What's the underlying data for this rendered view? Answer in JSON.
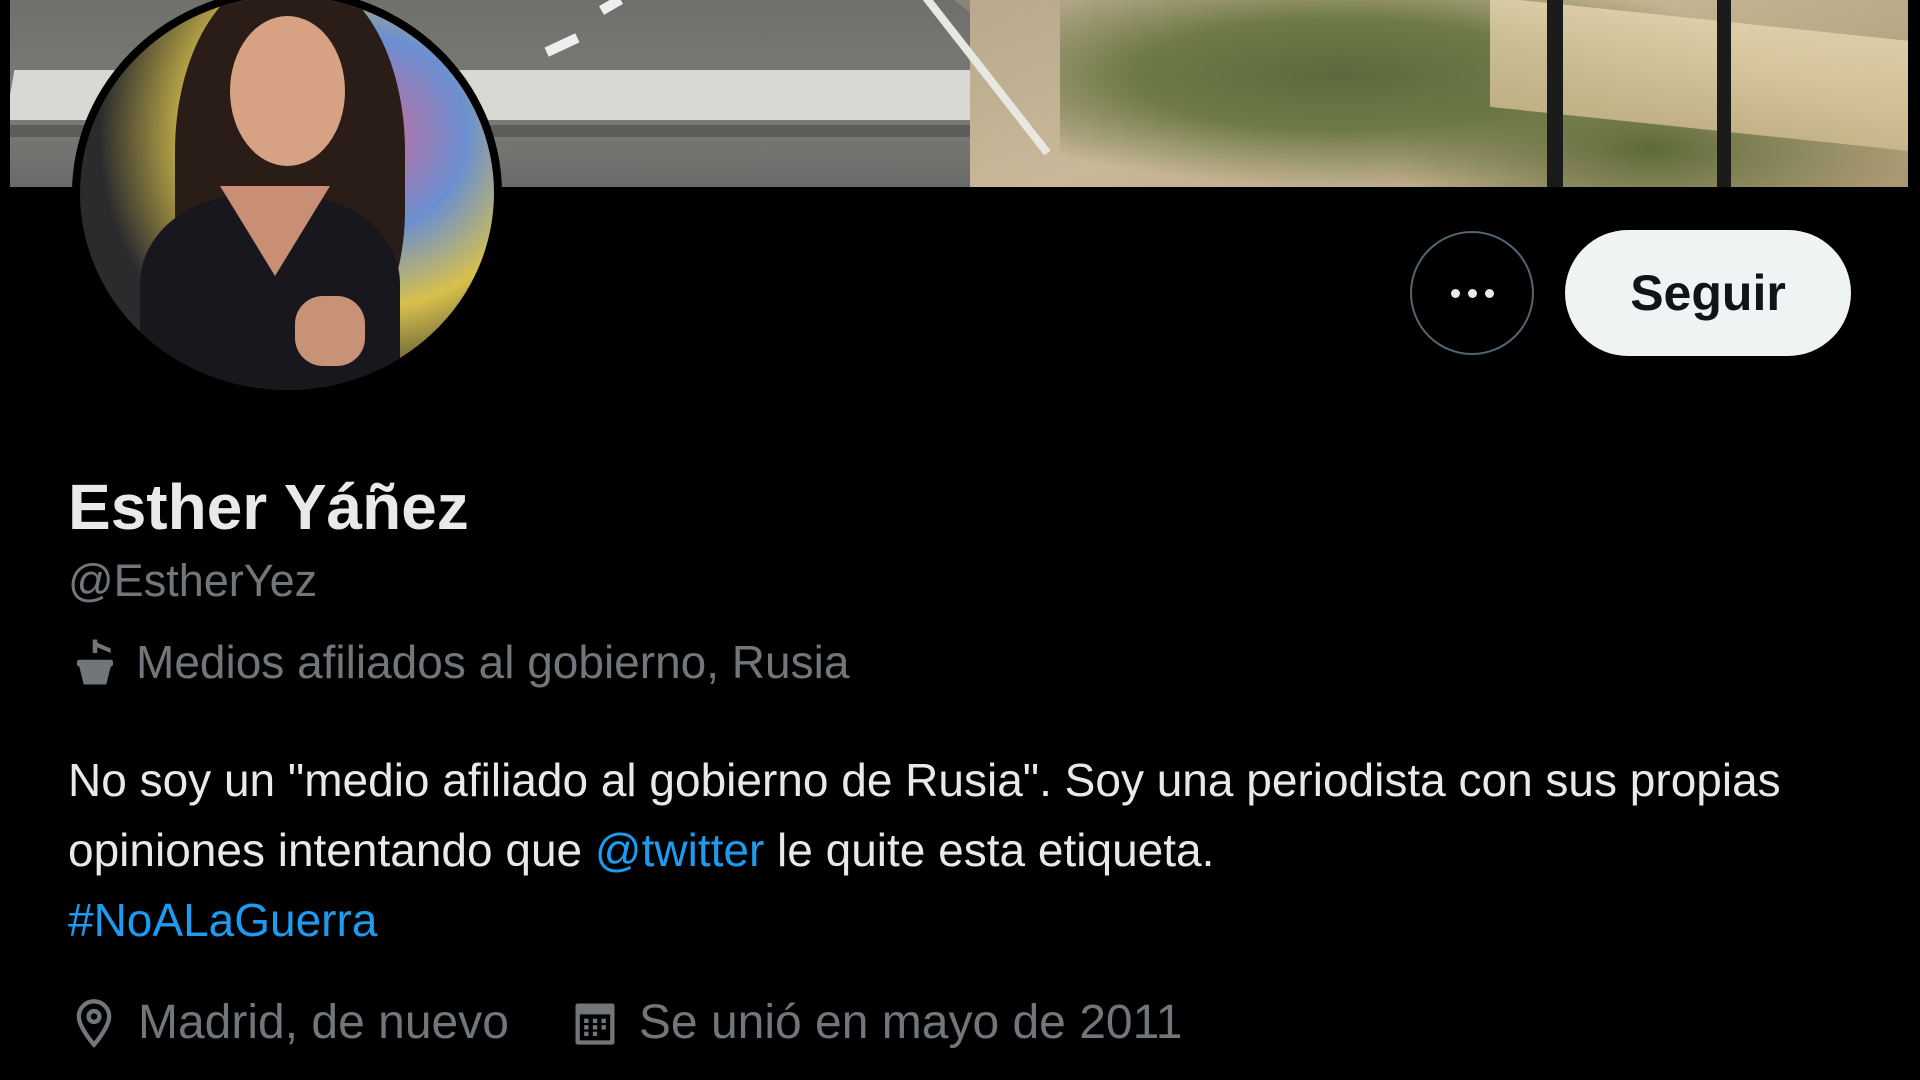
{
  "profile": {
    "name": "Esther Yáñez",
    "handle": "@EstherYez",
    "label": {
      "icon": "podium-icon",
      "text": "Medios afiliados al gobierno, Rusia"
    },
    "bio": {
      "part1": "No soy un \"medio afiliado al gobierno de Rusia\". Soy una periodista con sus propias opiniones intentando que ",
      "mention": "@twitter",
      "part2": " le quite esta etiqueta.",
      "hashtag": "#NoALaGuerra"
    },
    "location": {
      "icon": "location-pin-icon",
      "text": "Madrid, de nuevo"
    },
    "joined": {
      "icon": "calendar-icon",
      "text": "Se unió en mayo de 2011"
    }
  },
  "actions": {
    "more_icon": "more-dots-icon",
    "follow_label": "Seguir"
  },
  "colors": {
    "background": "#000000",
    "text_primary": "#e7e9ea",
    "text_secondary": "#71767b",
    "link": "#1d9bf0",
    "follow_button_bg": "#eff3f4"
  }
}
